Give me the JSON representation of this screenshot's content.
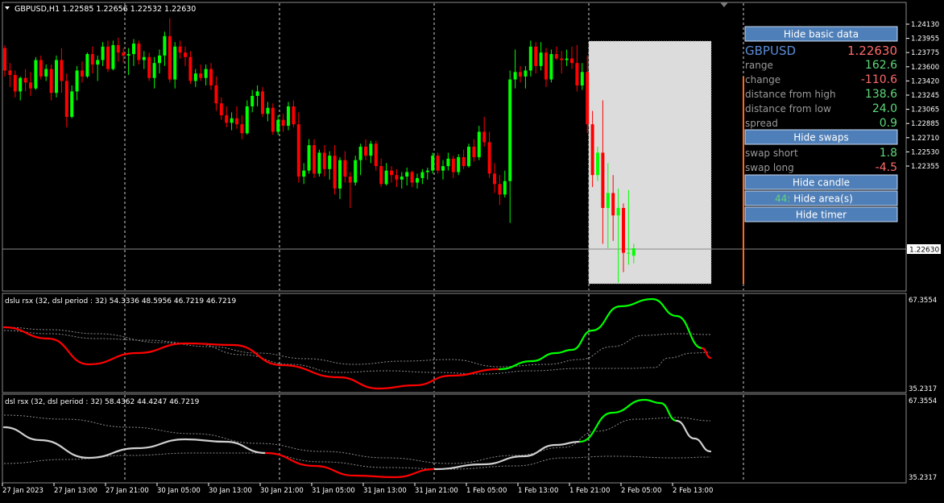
{
  "colors": {
    "background": "#000000",
    "bull": "#00ff00",
    "bear": "#ff0000",
    "neutral_line": "#d0d0d0",
    "grid": "#ffffff",
    "button_fill": "#4f7fb8",
    "label_gray": "#9a9a9a",
    "value_red": "#ff6a6a",
    "value_green": "#5ed87a",
    "symbol_blue": "#5b8cd6",
    "highlight_area": "#dcdcdc"
  },
  "main_chart": {
    "title": "GBPUSD,H1  1.22585 1.22656 1.22532 1.22630",
    "current_price_label": "1.22630",
    "price_ticks": [
      "1.24130",
      "1.23955",
      "1.23775",
      "1.23600",
      "1.23420",
      "1.23245",
      "1.23065",
      "1.22885",
      "1.22710",
      "1.22530",
      "1.22355"
    ]
  },
  "info_panel": {
    "hide_basic_label": "Hide basic data",
    "symbol": "GBPUSD",
    "price": "1.22630",
    "rows": [
      {
        "label": "range",
        "value": "162.6",
        "color": "#5ed87a"
      },
      {
        "label": "change",
        "value": "-110.6",
        "color": "#ff6a6a"
      },
      {
        "label": "distance from high",
        "value": "138.6",
        "color": "#5ed87a"
      },
      {
        "label": "distance from low",
        "value": "24.0",
        "color": "#5ed87a"
      },
      {
        "label": "spread",
        "value": "0.9",
        "color": "#5ed87a"
      }
    ],
    "hide_swaps_label": "Hide swaps",
    "swap_rows": [
      {
        "label": "swap short",
        "value": "1.8",
        "color": "#5ed87a"
      },
      {
        "label": "swap long",
        "value": "-4.5",
        "color": "#ff6a6a"
      }
    ],
    "hide_candle_label": "Hide candle",
    "hide_area_label": "Hide area(s)",
    "hide_area_overlay": "44:",
    "hide_timer_label": "Hide timer"
  },
  "indicator1": {
    "title": "dslu rsx (32, dsl period : 32) 54.3336 48.5956 46.7219 46.7219",
    "top_tick": "67.3554",
    "bottom_tick": "35.2317"
  },
  "indicator2": {
    "title": "dsl rsx (32, dsl period : 32) 58.4362 44.4247 46.7219",
    "top_tick": "67.3554",
    "bottom_tick": "35.2317"
  },
  "time_axis": [
    "27 Jan 2023",
    "27 Jan 13:00",
    "27 Jan 21:00",
    "30 Jan 05:00",
    "30 Jan 13:00",
    "30 Jan 21:00",
    "31 Jan 05:00",
    "31 Jan 13:00",
    "31 Jan 21:00",
    "1 Feb 05:00",
    "1 Feb 13:00",
    "1 Feb 21:00",
    "2 Feb 05:00",
    "2 Feb 13:00"
  ],
  "chart_data": [
    {
      "type": "candlestick",
      "symbol": "GBPUSD",
      "timeframe": "H1",
      "ylim": [
        1.22355,
        1.2418
      ],
      "candles": [
        [
          1.2397,
          1.2399,
          1.2378,
          1.2382
        ],
        [
          1.2382,
          1.2387,
          1.2371,
          1.2379
        ],
        [
          1.2379,
          1.2382,
          1.2364,
          1.2368
        ],
        [
          1.2368,
          1.2378,
          1.2362,
          1.2377
        ],
        [
          1.2377,
          1.2383,
          1.2368,
          1.2374
        ],
        [
          1.2374,
          1.2381,
          1.2365,
          1.237
        ],
        [
          1.237,
          1.2391,
          1.2369,
          1.2389
        ],
        [
          1.2389,
          1.2392,
          1.2376,
          1.2378
        ],
        [
          1.2378,
          1.2386,
          1.2375,
          1.2383
        ],
        [
          1.2383,
          1.2386,
          1.2362,
          1.2367
        ],
        [
          1.2367,
          1.2392,
          1.2364,
          1.2389
        ],
        [
          1.2389,
          1.2397,
          1.2367,
          1.2375
        ],
        [
          1.2375,
          1.238,
          1.2344,
          1.2351
        ],
        [
          1.2351,
          1.2372,
          1.235,
          1.2368
        ],
        [
          1.2368,
          1.2385,
          1.2362,
          1.2382
        ],
        [
          1.2382,
          1.2388,
          1.2374,
          1.2378
        ],
        [
          1.2378,
          1.2394,
          1.2377,
          1.2393
        ],
        [
          1.2393,
          1.2398,
          1.238,
          1.2386
        ],
        [
          1.2386,
          1.2392,
          1.2375,
          1.2389
        ],
        [
          1.2389,
          1.2401,
          1.2385,
          1.2398
        ],
        [
          1.2398,
          1.2402,
          1.2381,
          1.2383
        ],
        [
          1.2383,
          1.2402,
          1.2382,
          1.2399
        ],
        [
          1.2399,
          1.2404,
          1.2388,
          1.2394
        ],
        [
          1.2394,
          1.2397,
          1.2387,
          1.2392
        ],
        [
          1.2392,
          1.2397,
          1.2379,
          1.2393
        ],
        [
          1.2393,
          1.2403,
          1.2385,
          1.24
        ],
        [
          1.24,
          1.2402,
          1.2386,
          1.2389
        ],
        [
          1.2389,
          1.2395,
          1.2383,
          1.2391
        ],
        [
          1.2391,
          1.2394,
          1.2375,
          1.2377
        ],
        [
          1.2377,
          1.2391,
          1.237,
          1.2387
        ],
        [
          1.2387,
          1.2396,
          1.238,
          1.2392
        ],
        [
          1.2392,
          1.2408,
          1.2385,
          1.2405
        ],
        [
          1.2405,
          1.2417,
          1.2374,
          1.2376
        ],
        [
          1.2376,
          1.2401,
          1.237,
          1.2398
        ],
        [
          1.2398,
          1.2402,
          1.239,
          1.2394
        ],
        [
          1.2394,
          1.2398,
          1.2385,
          1.2391
        ],
        [
          1.2391,
          1.2395,
          1.2373,
          1.2375
        ],
        [
          1.2375,
          1.2383,
          1.2371,
          1.238
        ],
        [
          1.238,
          1.2386,
          1.2375,
          1.2377
        ],
        [
          1.2377,
          1.2386,
          1.2372,
          1.2383
        ],
        [
          1.2383,
          1.2387,
          1.2369,
          1.2372
        ],
        [
          1.2372,
          1.2378,
          1.2355,
          1.236
        ],
        [
          1.236,
          1.2364,
          1.2349,
          1.2352
        ],
        [
          1.2352,
          1.2358,
          1.2344,
          1.2347
        ],
        [
          1.2347,
          1.2354,
          1.2342,
          1.235
        ],
        [
          1.235,
          1.2358,
          1.2343,
          1.2346
        ],
        [
          1.2346,
          1.2352,
          1.2336,
          1.234
        ],
        [
          1.234,
          1.2362,
          1.2339,
          1.2358
        ],
        [
          1.2358,
          1.2369,
          1.2354,
          1.2365
        ],
        [
          1.2365,
          1.2372,
          1.2358,
          1.2368
        ],
        [
          1.2368,
          1.2371,
          1.2351,
          1.2353
        ],
        [
          1.2353,
          1.2361,
          1.2348,
          1.2357
        ],
        [
          1.2357,
          1.236,
          1.2339,
          1.2341
        ],
        [
          1.2341,
          1.2352,
          1.2339,
          1.2349
        ],
        [
          1.2349,
          1.2353,
          1.2341,
          1.2345
        ],
        [
          1.2345,
          1.2361,
          1.2342,
          1.2358
        ],
        [
          1.2358,
          1.2362,
          1.2344,
          1.2346
        ],
        [
          1.2346,
          1.2354,
          1.2307,
          1.2311
        ],
        [
          1.2311,
          1.232,
          1.2306,
          1.2315
        ],
        [
          1.2315,
          1.2336,
          1.2313,
          1.2332
        ],
        [
          1.2332,
          1.2336,
          1.231,
          1.2313
        ],
        [
          1.2313,
          1.2329,
          1.2311,
          1.2327
        ],
        [
          1.2327,
          1.2332,
          1.2311,
          1.2316
        ],
        [
          1.2316,
          1.2328,
          1.2309,
          1.2325
        ],
        [
          1.2325,
          1.2332,
          1.2299,
          1.2303
        ],
        [
          1.2303,
          1.2324,
          1.2296,
          1.2322
        ],
        [
          1.2322,
          1.2328,
          1.2307,
          1.2311
        ],
        [
          1.2311,
          1.2314,
          1.229,
          1.2307
        ],
        [
          1.2307,
          1.2325,
          1.2305,
          1.2322
        ],
        [
          1.2322,
          1.2333,
          1.2312,
          1.2331
        ],
        [
          1.2331,
          1.2336,
          1.2322,
          1.2325
        ],
        [
          1.2325,
          1.2335,
          1.232,
          1.2333
        ],
        [
          1.2333,
          1.2335,
          1.2315,
          1.2318
        ],
        [
          1.2318,
          1.2323,
          1.2304,
          1.2306
        ],
        [
          1.2306,
          1.232,
          1.2305,
          1.2315
        ],
        [
          1.2315,
          1.2318,
          1.2307,
          1.2312
        ],
        [
          1.2312,
          1.2316,
          1.2304,
          1.2309
        ],
        [
          1.2309,
          1.2314,
          1.2303,
          1.2311
        ],
        [
          1.2311,
          1.2317,
          1.2305,
          1.2314
        ],
        [
          1.2314,
          1.2315,
          1.2304,
          1.2307
        ],
        [
          1.2307,
          1.2313,
          1.2303,
          1.231
        ],
        [
          1.231,
          1.2316,
          1.2306,
          1.2314
        ],
        [
          1.2314,
          1.2317,
          1.2309,
          1.2315
        ],
        [
          1.2315,
          1.2327,
          1.2313,
          1.2325
        ],
        [
          1.2325,
          1.2327,
          1.2313,
          1.2315
        ],
        [
          1.2315,
          1.2322,
          1.2309,
          1.2318
        ],
        [
          1.2318,
          1.2327,
          1.2315,
          1.2323
        ],
        [
          1.2323,
          1.2325,
          1.231,
          1.2314
        ],
        [
          1.2314,
          1.2326,
          1.2312,
          1.2324
        ],
        [
          1.2324,
          1.2329,
          1.2316,
          1.2318
        ],
        [
          1.2318,
          1.2333,
          1.2317,
          1.2331
        ],
        [
          1.2331,
          1.2336,
          1.2321,
          1.2324
        ],
        [
          1.2324,
          1.2345,
          1.2322,
          1.2341
        ],
        [
          1.2341,
          1.2351,
          1.2331,
          1.2334
        ],
        [
          1.2334,
          1.2341,
          1.231,
          1.2313
        ],
        [
          1.2313,
          1.232,
          1.23,
          1.2306
        ],
        [
          1.2306,
          1.2312,
          1.2292,
          1.2299
        ],
        [
          1.2299,
          1.2315,
          1.2297,
          1.2308
        ],
        [
          1.2308,
          1.2382,
          1.228,
          1.2376
        ],
        [
          1.2376,
          1.2396,
          1.237,
          1.2381
        ],
        [
          1.2381,
          1.2385,
          1.2374,
          1.2378
        ],
        [
          1.2378,
          1.2385,
          1.237,
          1.2382
        ],
        [
          1.2382,
          1.2402,
          1.2378,
          1.2398
        ],
        [
          1.2398,
          1.2401,
          1.238,
          1.2385
        ],
        [
          1.2385,
          1.2401,
          1.2382,
          1.2394
        ],
        [
          1.2394,
          1.2397,
          1.2371,
          1.2376
        ],
        [
          1.2376,
          1.2396,
          1.2374,
          1.2393
        ],
        [
          1.2393,
          1.2398,
          1.2389,
          1.239
        ],
        [
          1.239,
          1.2395,
          1.238,
          1.2389
        ],
        [
          1.2389,
          1.2396,
          1.2385,
          1.239
        ],
        [
          1.239,
          1.2398,
          1.2383,
          1.2387
        ],
        [
          1.2387,
          1.2399,
          1.2368,
          1.2372
        ],
        [
          1.2372,
          1.2387,
          1.2369,
          1.2381
        ],
        [
          1.2381,
          1.2392,
          1.234,
          1.2346
        ],
        [
          1.2346,
          1.2355,
          1.2304,
          1.2312
        ],
        [
          1.2312,
          1.2331,
          1.2308,
          1.2327
        ],
        [
          1.2327,
          1.2362,
          1.2266,
          1.229
        ],
        [
          1.229,
          1.232,
          1.2263,
          1.23
        ],
        [
          1.23,
          1.2312,
          1.2268,
          1.2285
        ],
        [
          1.2285,
          1.2303,
          1.224,
          1.229
        ],
        [
          1.229,
          1.2293,
          1.2247,
          1.226
        ],
        [
          1.226,
          1.2302,
          1.2252,
          1.226
        ],
        [
          1.2258,
          1.2266,
          1.2253,
          1.2263
        ]
      ]
    },
    {
      "type": "line",
      "name": "dslu rsx (32, dsl period : 32)",
      "ylim": [
        35.2317,
        67.3554
      ],
      "values": [
        54.3336,
        48.5956,
        46.7219,
        46.7219
      ]
    },
    {
      "type": "line",
      "name": "dsl rsx (32, dsl period : 32)",
      "ylim": [
        35.2317,
        67.3554
      ],
      "values": [
        58.4362,
        44.4247,
        46.7219
      ]
    }
  ]
}
